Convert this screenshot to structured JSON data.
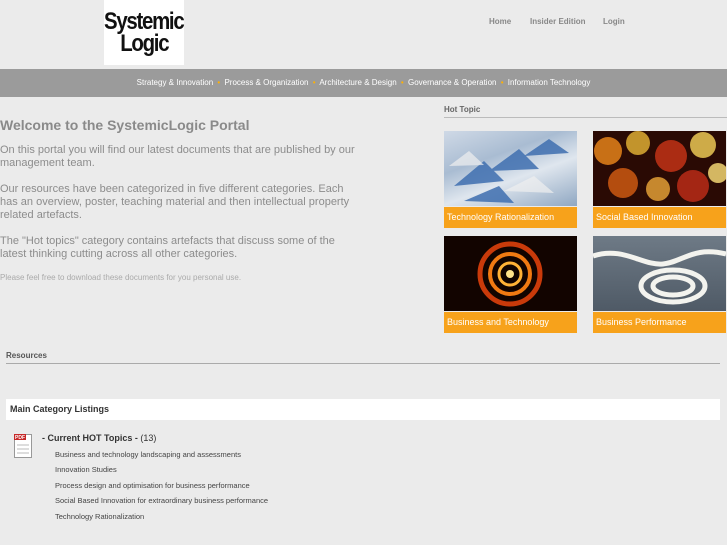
{
  "logo": {
    "line1": "Systemic",
    "line2": "Logic"
  },
  "top_nav": {
    "home": "Home",
    "insider": "Insider Edition",
    "login": "Login"
  },
  "menu": {
    "items": [
      "Strategy & Innovation",
      "Process & Organization",
      "Architecture & Design",
      "Governance & Operation",
      "Information Technology"
    ],
    "separator": "•",
    "separator_color": "#ffb100"
  },
  "welcome": {
    "title": "Welcome to the SystemicLogic Portal",
    "p1": "On this portal you will find our latest documents that are published by our management team.",
    "p2": "Our resources have been categorized in five different categories. Each has an overview, poster, teaching material and then intellectual property related artefacts.",
    "p3": "The \"Hot topics\" category contains artefacts that discuss some of the latest thinking cutting across all other categories.",
    "p4": "Please feel free to download these documents for you personal use."
  },
  "hot_topic": {
    "heading": "Hot Topic",
    "tiles": [
      {
        "label": "Technology Rationalization",
        "icon": "umbrellas-image"
      },
      {
        "label": "Social Based Innovation",
        "icon": "bokeh-lights-image"
      },
      {
        "label": "Business and Technology",
        "icon": "fire-spiral-image"
      },
      {
        "label": "Business Performance",
        "icon": "rope-knot-image"
      }
    ],
    "caption_color": "#f7a21b"
  },
  "resources": {
    "heading": "Resources",
    "category_box": "Main Category Listings",
    "hot_title": "- Current HOT Topics -",
    "hot_count": "(13)",
    "pdf_label": "PDF",
    "items": [
      "Business and technology landscaping and assessments",
      "Innovation Studies",
      "Process design and optimisation for business performance",
      "Social Based Innovation for extraordinary business performance",
      "Technology Rationalization"
    ]
  }
}
